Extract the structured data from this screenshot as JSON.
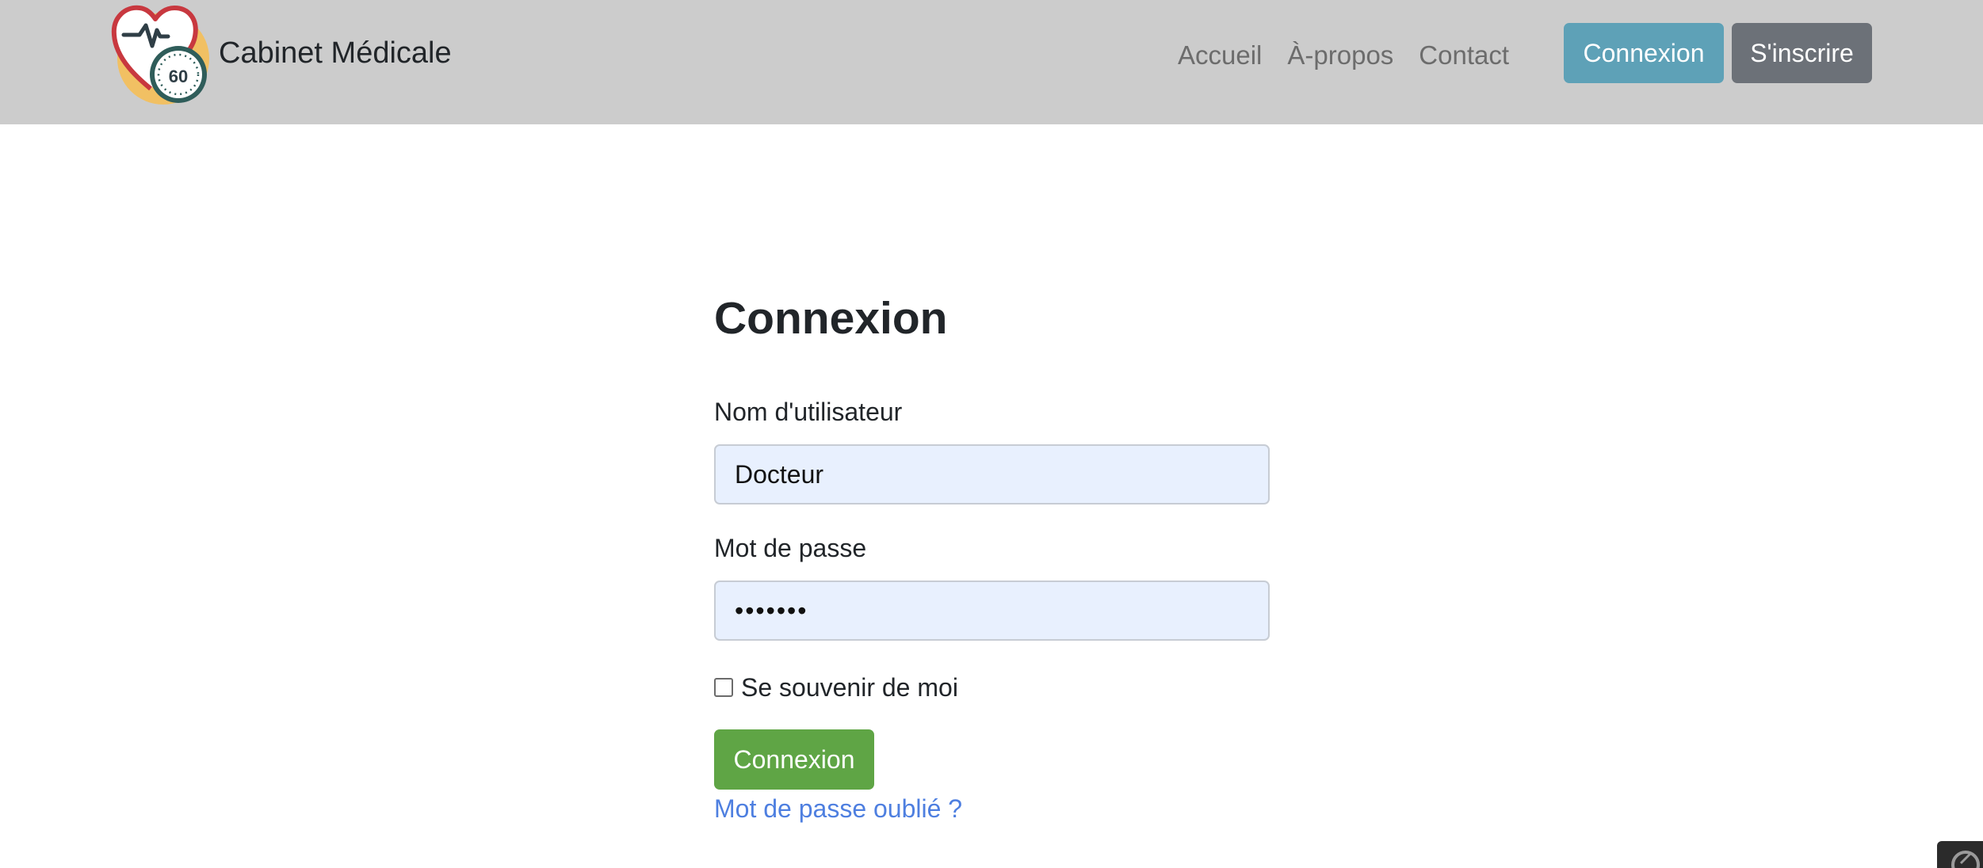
{
  "navbar": {
    "brand_name": "Cabinet Médicale",
    "logo_badge": "60",
    "links": [
      {
        "label": "Accueil"
      },
      {
        "label": "À-propos"
      },
      {
        "label": "Contact"
      }
    ],
    "login_button": "Connexion",
    "signup_button": "S'inscrire"
  },
  "login_form": {
    "title": "Connexion",
    "username_label": "Nom d'utilisateur",
    "username_value": "Docteur",
    "password_label": "Mot de passe",
    "password_value": "•••••••",
    "remember_label": "Se souvenir de moi",
    "remember_checked": false,
    "submit_button": "Connexion",
    "forgot_link": "Mot de passe oublié ?"
  },
  "colors": {
    "navbar_bg": "#cccccc",
    "login_button": "#5ea1b7",
    "signup_button": "#6c7178",
    "submit_button": "#5fa545",
    "link": "#4e7fe0",
    "input_bg": "#e8f0fe"
  },
  "icons": {
    "logo": "heart-pulse-stopwatch-icon",
    "corner_widget": "settings-icon"
  }
}
